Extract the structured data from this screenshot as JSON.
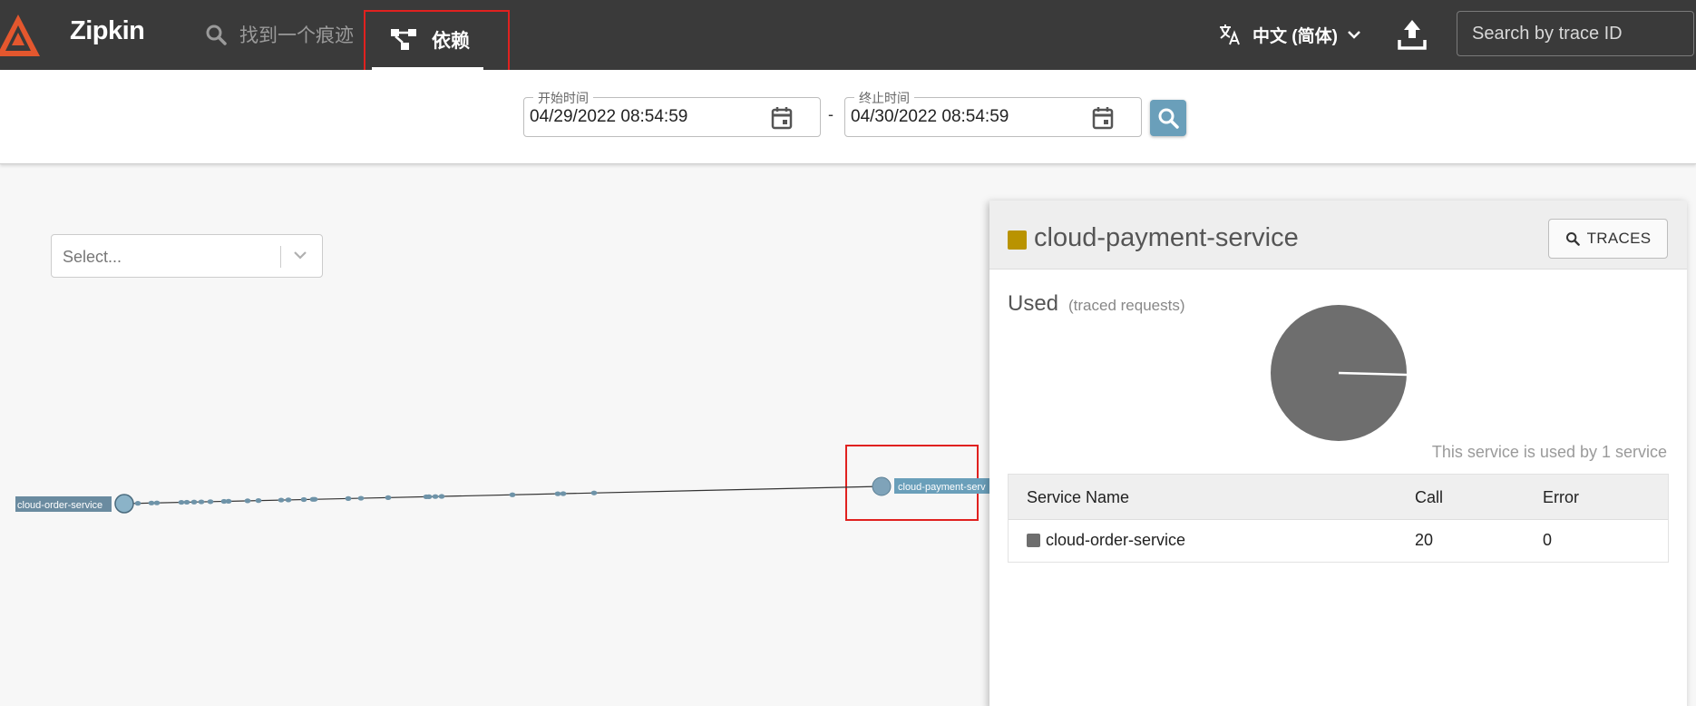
{
  "app": {
    "name": "Zipkin"
  },
  "nav": {
    "find_trace": "找到一个痕迹",
    "dependencies": "依赖"
  },
  "header": {
    "language": "中文 (简体)",
    "search_placeholder": "Search by trace ID"
  },
  "filters": {
    "start_label": "开始时间",
    "start_value": "04/29/2022 08:54:59",
    "separator": "-",
    "end_label": "终止时间",
    "end_value": "04/30/2022 08:54:59"
  },
  "service_select": {
    "placeholder": "Select..."
  },
  "graph": {
    "nodes": [
      {
        "id": "cloud-order-service",
        "label": "cloud-order-service"
      },
      {
        "id": "cloud-payment-service",
        "label": "cloud-payment-serv"
      }
    ],
    "edge": {
      "from": "cloud-order-service",
      "to": "cloud-payment-service"
    }
  },
  "detail": {
    "service_name": "cloud-payment-service",
    "service_color": "#b99300",
    "traces_button": "TRACES",
    "used_title": "Used",
    "used_subtitle": "(traced requests)",
    "used_by_text": "This service is used by 1 service",
    "table": {
      "headers": [
        "Service Name",
        "Call",
        "Error"
      ],
      "rows": [
        {
          "name": "cloud-order-service",
          "calls": "20",
          "errors": "0"
        }
      ]
    }
  },
  "colors": {
    "appbar": "#3a3a3a",
    "accent": "#6a9fba",
    "node": "#7fa3b9",
    "highlight": "#e0211f",
    "pie": "#6e6e6e"
  }
}
